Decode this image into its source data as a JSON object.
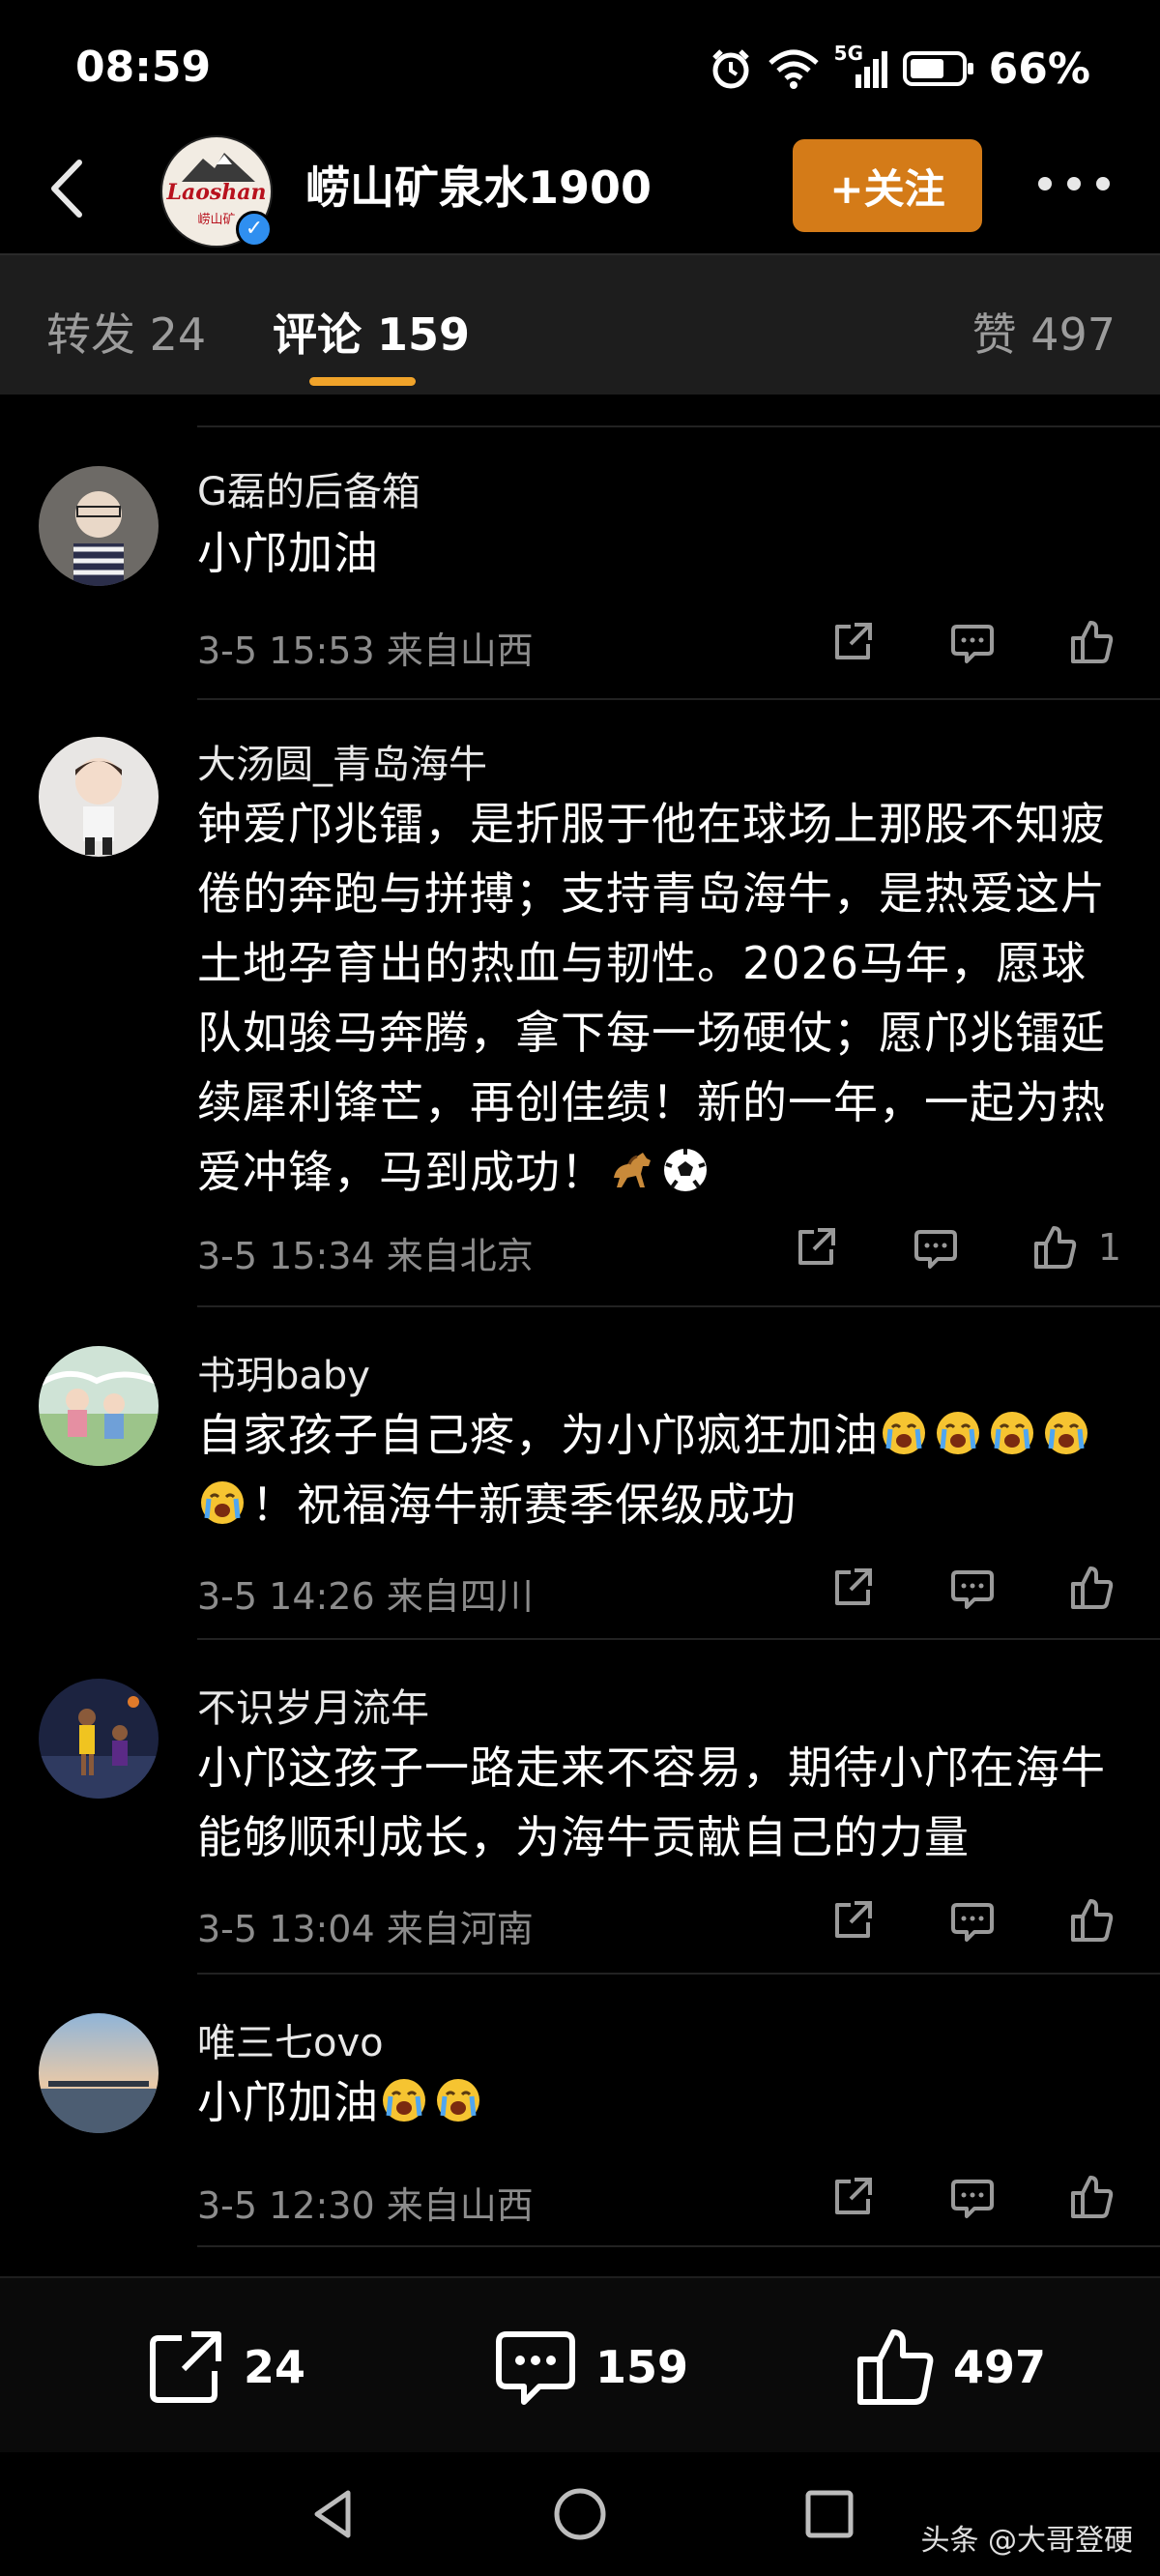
{
  "status_bar": {
    "time": "08:59",
    "network": "5G",
    "battery": "66%"
  },
  "header": {
    "account_name": "崂山矿泉水1900",
    "avatar_logo": "Laoshan",
    "avatar_logo_sub": "崂山矿",
    "follow_label": "+关注"
  },
  "tabs": {
    "repost": "转发 24",
    "comment": "评论 159",
    "like": "赞 497"
  },
  "comments": [
    {
      "user": "G磊的后备箱",
      "text": "小邝加油",
      "meta": "3-5 15:53  来自山西",
      "likes": ""
    },
    {
      "user": "大汤圆_青岛海牛",
      "text": "钟爱邝兆镭，是折服于他在球场上那股不知疲倦的奔跑与拼搏；支持青岛海牛，是热爱这片土地孕育出的热血与韧性。2026马年，愿球队如骏马奔腾，拿下每一场硬仗；愿邝兆镭延续犀利锋芒，再创佳绩！新的一年，一起为热爱冲锋，马到成功！",
      "meta": "3-5 15:34  来自北京",
      "likes": "1"
    },
    {
      "user": "书玥baby",
      "text_a": "自家孩子自己疼，为小邝疯狂加油",
      "text_b": "！祝福海牛新赛季保级成功",
      "meta": "3-5 14:26  来自四川",
      "likes": ""
    },
    {
      "user": "不识岁月流年",
      "text": "小邝这孩子一路走来不容易，期待小邝在海牛能够顺利成长，为海牛贡献自己的力量",
      "meta": "3-5 13:04  来自河南",
      "likes": ""
    },
    {
      "user": "唯三七ovo",
      "text": "小邝加油",
      "meta": "3-5 12:30  来自山西",
      "likes": ""
    }
  ],
  "bottom_bar": {
    "repost_count": "24",
    "comment_count": "159",
    "like_count": "497"
  },
  "watermark": "头条 @大哥登硬",
  "colors": {
    "accent": "#d47b18",
    "tab_underline": "#f0a32a",
    "verified": "#2f8ff0"
  },
  "icons": [
    "back-icon",
    "alarm-icon",
    "wifi-icon",
    "signal-icon",
    "battery-icon",
    "more-icon",
    "share-icon",
    "comment-icon",
    "like-icon",
    "horse-emoji",
    "soccer-emoji",
    "crying-emoji",
    "nav-back-icon",
    "nav-home-icon",
    "nav-recent-icon"
  ]
}
